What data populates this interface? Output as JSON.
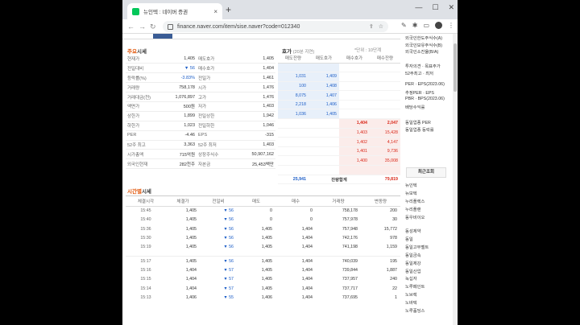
{
  "browser": {
    "tab_title": "뉴인텍 : 네이버 증권",
    "url": "finance.naver.com/item/sise.naver?code=012340"
  },
  "sections": {
    "quote_hi": "주요",
    "quote_rest": "시세",
    "orderbook": "호가",
    "orderbook_sub": "(20분 지연)",
    "orderbook_note": "*단위 : 10단계",
    "trades_hi": "시간별",
    "trades_rest": "시세"
  },
  "quote_rows": [
    {
      "k1": "현재가",
      "v1": "1,405",
      "k2": "매도호가",
      "v2": "1,405"
    },
    {
      "k1": "전일대비",
      "v1": "▼ 56",
      "k2": "매수호가",
      "v2": "1,404"
    },
    {
      "k1": "등락률(%)",
      "v1": "-3.83%",
      "k2": "전일가",
      "v2": "1,461"
    },
    {
      "k1": "거래량",
      "v1": "758,178",
      "k2": "시가",
      "v2": "1,476"
    },
    {
      "k1": "거래대금(천)",
      "v1": "1,076,897",
      "k2": "고가",
      "v2": "1,476"
    },
    {
      "k1": "액면가",
      "v1": "500원",
      "k2": "저가",
      "v2": "1,403"
    },
    {
      "k1": "상한가",
      "v1": "1,899",
      "k2": "전일상한",
      "v2": "1,942"
    },
    {
      "k1": "하한가",
      "v1": "1,023",
      "k2": "전일하한",
      "v2": "1,046"
    },
    {
      "k1": "PER",
      "v1": "-4.46",
      "k2": "EPS",
      "v2": "-315"
    },
    {
      "k1": "52주 최고",
      "v1": "3,363",
      "k2": "52주 최저",
      "v2": "1,403"
    },
    {
      "k1": "시가총액",
      "v1": "715억원",
      "k2": "상장주식수",
      "v2": "50,907,162"
    },
    {
      "k1": "외국인현재",
      "v1": "282천주",
      "k2": "자본금",
      "v2": "25,453백만"
    }
  ],
  "orderbook": {
    "headers": [
      "매도잔량",
      "매도호가",
      "매수호가",
      "매수잔량"
    ],
    "asks": [
      {
        "q": "",
        "p": ""
      },
      {
        "q": "1,031",
        "p": "1,409"
      },
      {
        "q": "100",
        "p": "1,408"
      },
      {
        "q": "8,075",
        "p": "1,407"
      },
      {
        "q": "2,218",
        "p": "1,406"
      },
      {
        "q": "1,036",
        "p": "1,405"
      }
    ],
    "bids": [
      {
        "p": "1,404",
        "q": "2,047"
      },
      {
        "p": "1,403",
        "q": "15,428"
      },
      {
        "p": "1,402",
        "q": "4,147"
      },
      {
        "p": "1,401",
        "q": "9,736"
      },
      {
        "p": "1,400",
        "q": "35,008"
      },
      {
        "p": "",
        "q": ""
      }
    ],
    "total_ask": "25,941",
    "total_label": "잔량합계",
    "total_bid": "79,819"
  },
  "trades": {
    "headers": [
      "체결시각",
      "체결가",
      "전일비",
      "매도",
      "매수",
      "거래량",
      "변동량"
    ],
    "rows": [
      {
        "t": "15:45",
        "p": "1,405",
        "c": "▼ 56",
        "s": "0",
        "b": "0",
        "v": "758,178",
        "d": "200"
      },
      {
        "t": "15:40",
        "p": "1,405",
        "c": "▼ 56",
        "s": "0",
        "b": "0",
        "v": "757,978",
        "d": "30"
      },
      {
        "t": "15:36",
        "p": "1,405",
        "c": "▼ 56",
        "s": "1,405",
        "b": "1,404",
        "v": "757,948",
        "d": "15,772"
      },
      {
        "t": "15:30",
        "p": "1,405",
        "c": "▼ 56",
        "s": "1,405",
        "b": "1,404",
        "v": "742,176",
        "d": "978"
      },
      {
        "t": "15:19",
        "p": "1,405",
        "c": "▼ 56",
        "s": "1,405",
        "b": "1,404",
        "v": "741,198",
        "d": "1,159"
      },
      {
        "t": "15:17",
        "p": "1,405",
        "c": "▼ 56",
        "s": "1,405",
        "b": "1,404",
        "v": "740,039",
        "d": "195"
      },
      {
        "t": "15:16",
        "p": "1,404",
        "c": "▼ 57",
        "s": "1,405",
        "b": "1,404",
        "v": "739,844",
        "d": "1,887"
      },
      {
        "t": "15:15",
        "p": "1,404",
        "c": "▼ 57",
        "s": "1,405",
        "b": "1,404",
        "v": "737,957",
        "d": "240"
      },
      {
        "t": "15:14",
        "p": "1,404",
        "c": "▼ 57",
        "s": "1,405",
        "b": "1,404",
        "v": "737,717",
        "d": "22"
      },
      {
        "t": "15:13",
        "p": "1,406",
        "c": "▼ 55",
        "s": "1,406",
        "b": "1,404",
        "v": "737,695",
        "d": "1"
      }
    ]
  },
  "sidebar": {
    "top": [
      "외국인한도주식수(A)",
      "외국인보유주식수(B)",
      "외국인소진율(B/A)"
    ],
    "mid": [
      "투자의견 · 목표주가",
      "52주최고 · 최저"
    ],
    "per": [
      "PER · EPS(2023.06)",
      "추정PER · EPS",
      "PBR · BPS(2023.06)",
      "배당수익률"
    ],
    "ind": [
      "동일업종 PER",
      "동일업종 등락률"
    ],
    "recent_title": "최근조회",
    "recent1": [
      "뉴인텍",
      "뉴보텍",
      "누리플렉스",
      "누리플랜",
      "동우비이오"
    ],
    "recent2": [
      "동성제약",
      "동일",
      "동일고무벨트",
      "동일금속",
      "동일제강",
      "동일산업"
    ],
    "recent3": [
      "녹십자",
      "노루페인트",
      "노브렉",
      "노바텍",
      "노루홀딩스"
    ]
  }
}
